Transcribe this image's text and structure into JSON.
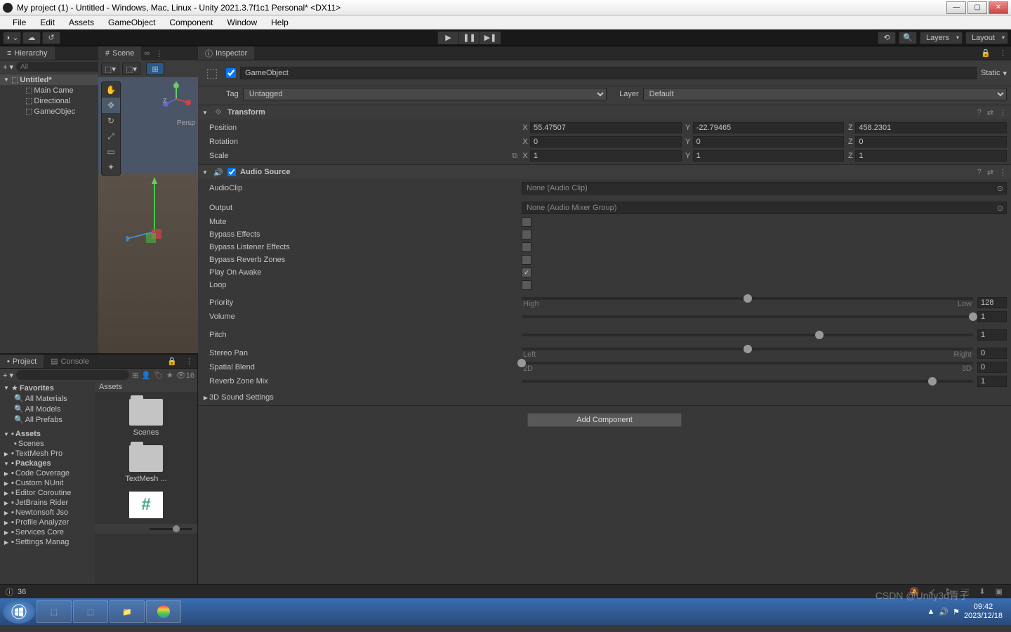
{
  "window": {
    "title": "My project (1) - Untitled - Windows, Mac, Linux - Unity 2021.3.7f1c1 Personal* <DX11>"
  },
  "menubar": [
    "File",
    "Edit",
    "Assets",
    "GameObject",
    "Component",
    "Window",
    "Help"
  ],
  "toolbar": {
    "layers": "Layers",
    "layout": "Layout"
  },
  "hierarchy": {
    "tab": "Hierarchy",
    "search_placeholder": "All",
    "scene": "Untitled*",
    "items": [
      "Main Came",
      "Directional",
      "GameObjec"
    ]
  },
  "scene": {
    "tab": "Scene",
    "persp": "Persp"
  },
  "project": {
    "tab_project": "Project",
    "tab_console": "Console",
    "toolbar_count": "16",
    "favorites": "Favorites",
    "fav_items": [
      "All Materials",
      "All Models",
      "All Prefabs"
    ],
    "assets_label": "Assets",
    "assets_items": [
      "Scenes",
      "TextMesh Pro"
    ],
    "packages_label": "Packages",
    "package_items": [
      "Code Coverage",
      "Custom NUnit",
      "Editor Coroutine",
      "JetBrains Rider",
      "Newtonsoft Jso",
      "Profile Analyzer",
      "Services Core",
      "Settings Manag"
    ],
    "header": "Assets",
    "folders": [
      "Scenes",
      "TextMesh ..."
    ]
  },
  "inspector": {
    "tab": "Inspector",
    "object_name": "GameObject",
    "static_label": "Static",
    "tag_label": "Tag",
    "tag_value": "Untagged",
    "layer_label": "Layer",
    "layer_value": "Default",
    "transform": {
      "name": "Transform",
      "position_label": "Position",
      "rotation_label": "Rotation",
      "scale_label": "Scale",
      "position": {
        "x": "55.47507",
        "y": "-22.79465",
        "z": "458.2301"
      },
      "rotation": {
        "x": "0",
        "y": "0",
        "z": "0"
      },
      "scale": {
        "x": "1",
        "y": "1",
        "z": "1"
      }
    },
    "audio": {
      "name": "Audio Source",
      "audioclip_label": "AudioClip",
      "audioclip_value": "None (Audio Clip)",
      "output_label": "Output",
      "output_value": "None (Audio Mixer Group)",
      "mute_label": "Mute",
      "bypass_effects_label": "Bypass Effects",
      "bypass_listener_label": "Bypass Listener Effects",
      "bypass_reverb_label": "Bypass Reverb Zones",
      "play_awake_label": "Play On Awake",
      "loop_label": "Loop",
      "priority_label": "Priority",
      "priority_value": "128",
      "priority_left": "High",
      "priority_right": "Low",
      "volume_label": "Volume",
      "volume_value": "1",
      "pitch_label": "Pitch",
      "pitch_value": "1",
      "stereo_label": "Stereo Pan",
      "stereo_value": "0",
      "stereo_left": "Left",
      "stereo_right": "Right",
      "spatial_label": "Spatial Blend",
      "spatial_value": "0",
      "spatial_left": "2D",
      "spatial_right": "3D",
      "reverb_label": "Reverb Zone Mix",
      "reverb_value": "1",
      "sound3d_label": "3D Sound Settings"
    },
    "add_component": "Add Component"
  },
  "statusbar": {
    "count": "36"
  },
  "taskbar": {
    "time": "09:42",
    "date": "2023/12/18"
  },
  "watermark": "CSDN @Unity3d青子"
}
